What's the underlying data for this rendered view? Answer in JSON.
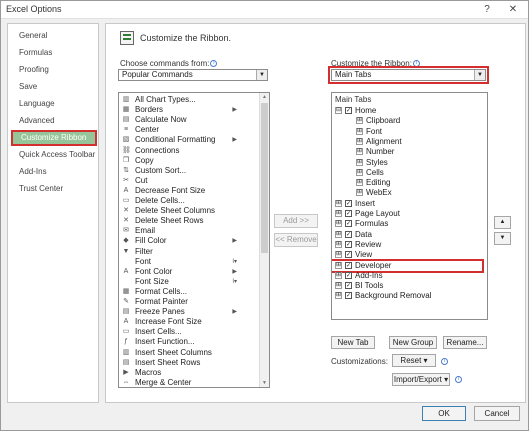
{
  "window": {
    "title": "Excel Options",
    "help_icon": "?",
    "close_icon": "✕"
  },
  "sidebar": {
    "items": [
      {
        "label": "General"
      },
      {
        "label": "Formulas"
      },
      {
        "label": "Proofing"
      },
      {
        "label": "Save"
      },
      {
        "label": "Language"
      },
      {
        "label": "Advanced"
      },
      {
        "label": "Customize Ribbon",
        "active": true
      },
      {
        "label": "Quick Access Toolbar"
      },
      {
        "label": "Add-Ins"
      },
      {
        "label": "Trust Center"
      }
    ]
  },
  "header": {
    "title": "Customize the Ribbon."
  },
  "left": {
    "label": "Choose commands from:",
    "value": "Popular Commands",
    "commands": [
      {
        "label": "All Chart Types...",
        "icon": "▥"
      },
      {
        "label": "Borders",
        "icon": "▦",
        "sub": "▶"
      },
      {
        "label": "Calculate Now",
        "icon": "▤"
      },
      {
        "label": "Center",
        "icon": "≡"
      },
      {
        "label": "Conditional Formatting",
        "icon": "▧",
        "sub": "▶"
      },
      {
        "label": "Connections",
        "icon": "⛓"
      },
      {
        "label": "Copy",
        "icon": "❐"
      },
      {
        "label": "Custom Sort...",
        "icon": "⇅"
      },
      {
        "label": "Cut",
        "icon": "✂"
      },
      {
        "label": "Decrease Font Size",
        "icon": "A"
      },
      {
        "label": "Delete Cells...",
        "icon": "▭"
      },
      {
        "label": "Delete Sheet Columns",
        "icon": "✕"
      },
      {
        "label": "Delete Sheet Rows",
        "icon": "✕"
      },
      {
        "label": "Email",
        "icon": "✉"
      },
      {
        "label": "Fill Color",
        "icon": "◆",
        "sub": "▶"
      },
      {
        "label": "Filter",
        "icon": "▼"
      },
      {
        "label": "Font",
        "icon": "",
        "sub": "I▾"
      },
      {
        "label": "Font Color",
        "icon": "A",
        "sub": "▶"
      },
      {
        "label": "Font Size",
        "icon": "",
        "sub": "I▾"
      },
      {
        "label": "Format Cells...",
        "icon": "▦"
      },
      {
        "label": "Format Painter",
        "icon": "✎"
      },
      {
        "label": "Freeze Panes",
        "icon": "▤",
        "sub": "▶"
      },
      {
        "label": "Increase Font Size",
        "icon": "A"
      },
      {
        "label": "Insert Cells...",
        "icon": "▭"
      },
      {
        "label": "Insert Function...",
        "icon": "ƒ"
      },
      {
        "label": "Insert Sheet Columns",
        "icon": "▥"
      },
      {
        "label": "Insert Sheet Rows",
        "icon": "▤"
      },
      {
        "label": "Macros",
        "icon": "▶"
      },
      {
        "label": "Merge & Center",
        "icon": "⇔"
      }
    ]
  },
  "middle": {
    "add": "Add >>",
    "remove": "<< Remove"
  },
  "right": {
    "label": "Customize the Ribbon:",
    "value": "Main Tabs",
    "tree_header": "Main Tabs",
    "tree": [
      {
        "label": "Home",
        "level": 0,
        "exp": "⊟",
        "chk": "✓"
      },
      {
        "label": "Clipboard",
        "level": 1,
        "exp": "⊞"
      },
      {
        "label": "Font",
        "level": 1,
        "exp": "⊞"
      },
      {
        "label": "Alignment",
        "level": 1,
        "exp": "⊞"
      },
      {
        "label": "Number",
        "level": 1,
        "exp": "⊞"
      },
      {
        "label": "Styles",
        "level": 1,
        "exp": "⊞"
      },
      {
        "label": "Cells",
        "level": 1,
        "exp": "⊞"
      },
      {
        "label": "Editing",
        "level": 1,
        "exp": "⊞"
      },
      {
        "label": "WebEx",
        "level": 1,
        "exp": "⊞"
      },
      {
        "label": "Insert",
        "level": 0,
        "exp": "⊞",
        "chk": "✓"
      },
      {
        "label": "Page Layout",
        "level": 0,
        "exp": "⊞",
        "chk": "✓"
      },
      {
        "label": "Formulas",
        "level": 0,
        "exp": "⊞",
        "chk": "✓"
      },
      {
        "label": "Data",
        "level": 0,
        "exp": "⊞",
        "chk": "✓"
      },
      {
        "label": "Review",
        "level": 0,
        "exp": "⊞",
        "chk": "✓"
      },
      {
        "label": "View",
        "level": 0,
        "exp": "⊞",
        "chk": "✓"
      },
      {
        "label": "Developer",
        "level": 0,
        "exp": "⊞",
        "chk": "✓",
        "highlight": true
      },
      {
        "label": "Add-Ins",
        "level": 0,
        "exp": "⊞",
        "chk": "✓"
      },
      {
        "label": "BI Tools",
        "level": 0,
        "exp": "⊞",
        "chk": "✓"
      },
      {
        "label": "Background Removal",
        "level": 0,
        "exp": "⊞",
        "chk": "✓"
      }
    ],
    "new_tab": "New Tab",
    "new_group": "New Group",
    "rename": "Rename...",
    "customizations_label": "Customizations:",
    "reset": "Reset ▾",
    "import_export": "Import/Export ▾",
    "move_up": "▲",
    "move_down": "▼"
  },
  "footer": {
    "ok": "OK",
    "cancel": "Cancel"
  }
}
